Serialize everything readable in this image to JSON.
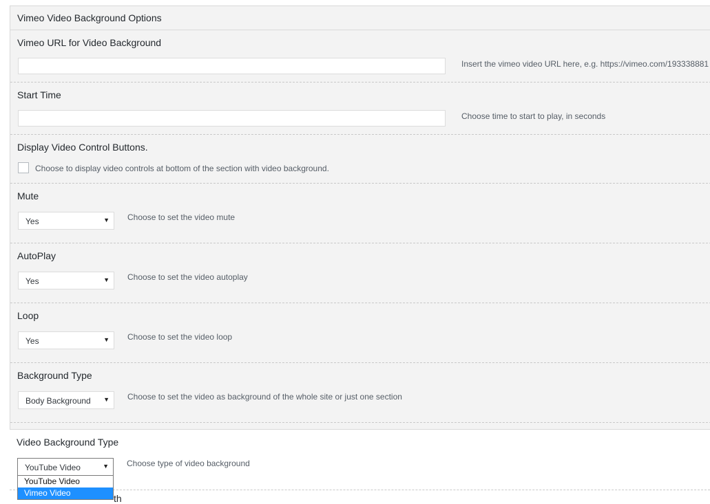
{
  "panel": {
    "title": "Vimeo Video Background Options"
  },
  "fields": {
    "vimeo_url": {
      "label": "Vimeo URL for Video Background",
      "value": "",
      "placeholder": "",
      "description": "Insert the vimeo video URL here, e.g. https://vimeo.com/193338881"
    },
    "start_time": {
      "label": "Start Time",
      "value": "",
      "placeholder": "",
      "description": "Choose time to start to play, in seconds"
    },
    "controls": {
      "label": "Display Video Control Buttons.",
      "checked": false,
      "description": "Choose to display video controls at bottom of the section with video background."
    },
    "mute": {
      "label": "Mute",
      "selected": "Yes",
      "description": "Choose to set the video mute"
    },
    "autoplay": {
      "label": "AutoPlay",
      "selected": "Yes",
      "description": "Choose to set the video autoplay"
    },
    "loop": {
      "label": "Loop",
      "selected": "Yes",
      "description": "Choose to set the video loop"
    },
    "background_type": {
      "label": "Background Type",
      "selected": "Body Background",
      "description": "Choose to set the video as background of the whole site or just one section"
    },
    "video_background_type": {
      "label": "Video Background Type",
      "selected": "YouTube Video",
      "description": "Choose type of video background",
      "options": [
        "YouTube Video",
        "Vimeo Video"
      ],
      "highlighted_option": "Vimeo Video"
    }
  },
  "partial_next_label": "th",
  "icons": {
    "select_arrow": "▼"
  }
}
